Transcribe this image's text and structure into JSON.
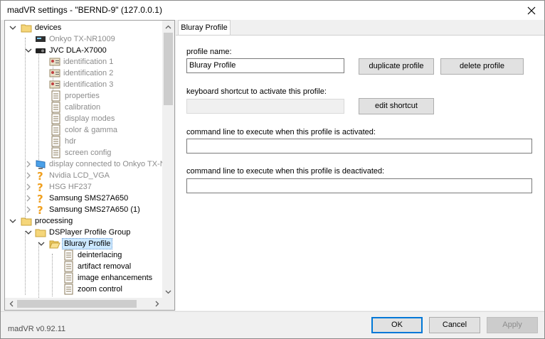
{
  "window": {
    "title": "madVR settings - \"BERND-9\" (127.0.0.1)",
    "version": "madVR v0.92.11"
  },
  "tree": {
    "items": [
      {
        "label": "devices",
        "icon": "folder-icon"
      },
      {
        "label": "Onkyo TX-NR1009",
        "icon": "receiver-icon"
      },
      {
        "label": "JVC DLA-X7000",
        "icon": "projector-icon"
      },
      {
        "label": "identification 1",
        "icon": "id-card-icon"
      },
      {
        "label": "identification 2",
        "icon": "id-card-icon"
      },
      {
        "label": "identification 3",
        "icon": "id-card-icon"
      },
      {
        "label": "properties",
        "icon": "page-icon"
      },
      {
        "label": "calibration",
        "icon": "page-icon"
      },
      {
        "label": "display modes",
        "icon": "page-icon"
      },
      {
        "label": "color & gamma",
        "icon": "page-icon"
      },
      {
        "label": "hdr",
        "icon": "page-icon"
      },
      {
        "label": "screen config",
        "icon": "page-icon"
      },
      {
        "label": "display connected to Onkyo TX-N",
        "icon": "monitor-icon"
      },
      {
        "label": "Nvidia LCD_VGA",
        "icon": "question-icon"
      },
      {
        "label": "HSG HF237",
        "icon": "question-icon"
      },
      {
        "label": "Samsung SMS27A650",
        "icon": "question-icon"
      },
      {
        "label": "Samsung SMS27A650 (1)",
        "icon": "question-icon"
      },
      {
        "label": "processing",
        "icon": "folder-icon"
      },
      {
        "label": "DSPlayer Profile Group",
        "icon": "folder-icon"
      },
      {
        "label": "Bluray Profile",
        "icon": "folder-open-icon"
      },
      {
        "label": "deinterlacing",
        "icon": "page-icon"
      },
      {
        "label": "artifact removal",
        "icon": "page-icon"
      },
      {
        "label": "image enhancements",
        "icon": "page-icon"
      },
      {
        "label": "zoom control",
        "icon": "page-icon"
      }
    ]
  },
  "tab": {
    "label": "Bluray Profile"
  },
  "profile": {
    "name_label": "profile name:",
    "name_value": "Bluray Profile",
    "duplicate_label": "duplicate profile",
    "delete_label": "delete profile",
    "shortcut_label": "keyboard shortcut to activate this profile:",
    "shortcut_value": "",
    "edit_shortcut_label": "edit shortcut",
    "cmd_activated_label": "command line to execute when this profile is activated:",
    "cmd_activated_value": "",
    "cmd_deactivated_label": "command line to execute when this profile is deactivated:",
    "cmd_deactivated_value": ""
  },
  "footer": {
    "ok_label": "OK",
    "cancel_label": "Cancel",
    "apply_label": "Apply"
  },
  "colors": {
    "selection": "#cce8ff",
    "default_button_border": "#0078d7",
    "folder": "#f5d67a"
  }
}
